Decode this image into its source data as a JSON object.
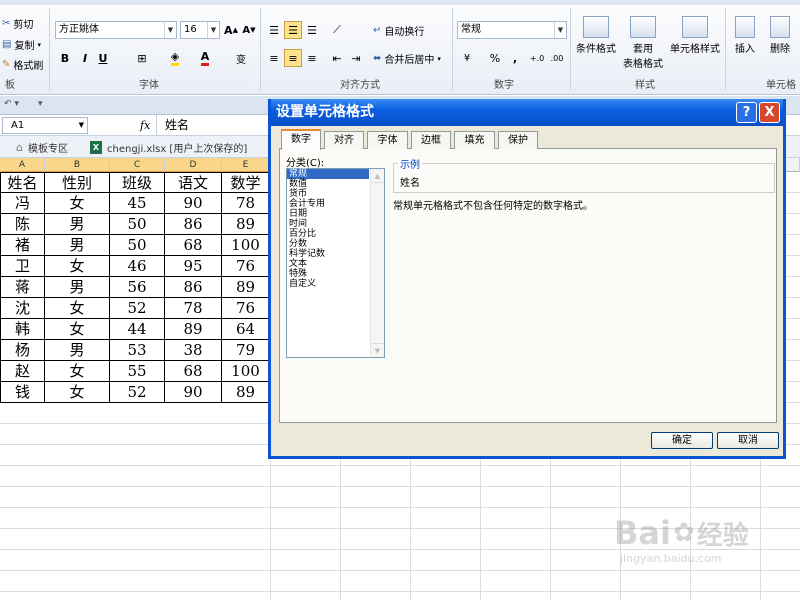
{
  "ribbon": {
    "clipboard": {
      "cut": "剪切",
      "copy": "复制",
      "painter": "格式刷",
      "group": "板"
    },
    "font": {
      "name": "方正姚体",
      "size": "16",
      "grow": "A",
      "shrink": "A",
      "bold": "B",
      "italic": "I",
      "underline": "U",
      "wen": "变",
      "group": "字体"
    },
    "align": {
      "wrap": "自动换行",
      "merge": "合并后居中",
      "group": "对齐方式"
    },
    "number": {
      "format": "常规",
      "percent": "%",
      "comma": ",",
      "group": "数字"
    },
    "styles": {
      "cond": "条件格式",
      "table": "套用",
      "table2": "表格格式",
      "cell": "单元格样式",
      "group": "样式"
    },
    "cells": {
      "insert": "插入",
      "delete": "删除",
      "group": "单元格"
    }
  },
  "formula_bar": {
    "namebox": "A1",
    "fx": "fx",
    "content": "姓名"
  },
  "tabs": {
    "template": "模板专区",
    "file": "chengji.xlsx [用户上次保存的]"
  },
  "sheet": {
    "columns": [
      "A",
      "B",
      "C",
      "D",
      "E"
    ],
    "headers": [
      "姓名",
      "性别",
      "班级",
      "语文",
      "数学"
    ],
    "rows": [
      [
        "冯",
        "女",
        "45",
        "90",
        "78"
      ],
      [
        "陈",
        "男",
        "50",
        "86",
        "89"
      ],
      [
        "褚",
        "男",
        "50",
        "68",
        "100"
      ],
      [
        "卫",
        "女",
        "46",
        "95",
        "76"
      ],
      [
        "蒋",
        "男",
        "56",
        "86",
        "89"
      ],
      [
        "沈",
        "女",
        "52",
        "78",
        "76"
      ],
      [
        "韩",
        "女",
        "44",
        "89",
        "64"
      ],
      [
        "杨",
        "男",
        "53",
        "38",
        "79"
      ],
      [
        "赵",
        "女",
        "55",
        "68",
        "100"
      ],
      [
        "钱",
        "女",
        "52",
        "90",
        "89"
      ]
    ]
  },
  "dialog": {
    "title": "设置单元格格式",
    "help": "?",
    "close": "X",
    "tabs": [
      "数字",
      "对齐",
      "字体",
      "边框",
      "填充",
      "保护"
    ],
    "category_label": "分类(C):",
    "categories": [
      "常规",
      "数值",
      "货币",
      "会计专用",
      "日期",
      "时间",
      "百分比",
      "分数",
      "科学记数",
      "文本",
      "特殊",
      "自定义"
    ],
    "sample_label": "示例",
    "sample_value": "姓名",
    "description": "常规单元格格式不包含任何特定的数字格式。",
    "ok": "确定",
    "cancel": "取消"
  },
  "watermark": {
    "brand": "Bai",
    "sub": "经验",
    "url": "jingyan.baidu.com"
  },
  "colors": {
    "dialog_border": "#0b54d6",
    "selected_item": "#316ac5",
    "header_highlight": "#f9d68a"
  }
}
